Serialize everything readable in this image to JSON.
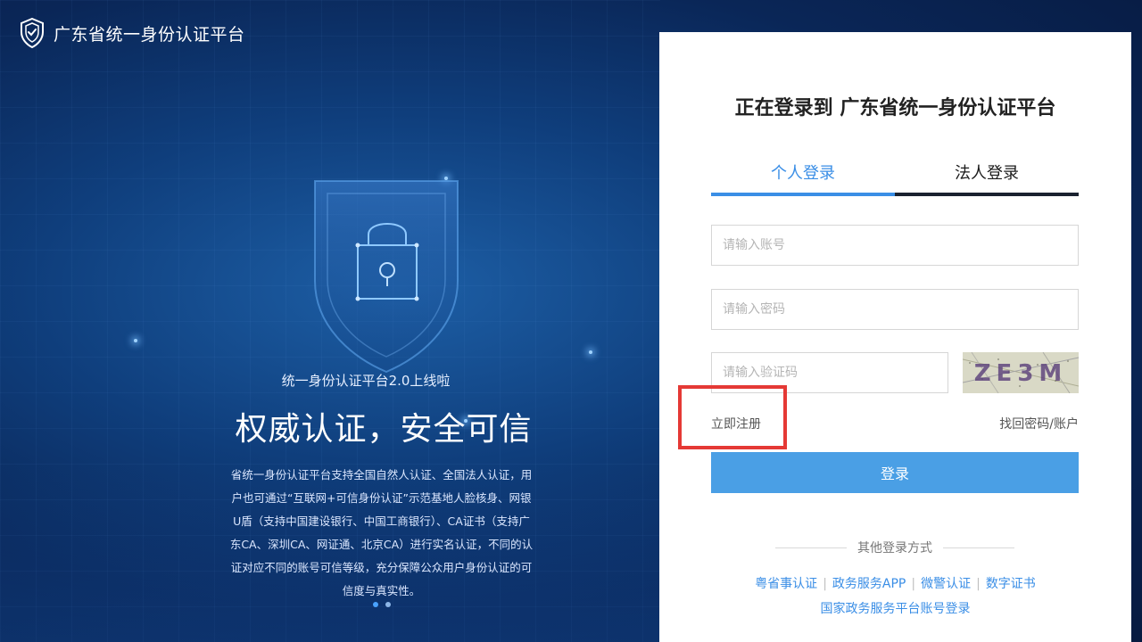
{
  "brand": {
    "name": "广东省统一身份认证平台",
    "icon": "shield-check-icon"
  },
  "hero": {
    "subtitle": "统一身份认证平台2.0上线啦",
    "title": "权威认证，安全可信",
    "description": "省统一身份认证平台支持全国自然人认证、全国法人认证，用户也可通过“互联网+可信身份认证”示范基地人脸核身、网银U盾（支持中国建设银行、中国工商银行）、CA证书（支持广东CA、深圳CA、网证通、北京CA）进行实名认证，不同的认证对应不同的账号可信等级，充分保障公众用户身份认证的可信度与真实性。",
    "illustration": "shield-lock-icon",
    "carousel_total": 2,
    "carousel_active": 0
  },
  "login": {
    "title": "正在登录到 广东省统一身份认证平台",
    "tabs": [
      {
        "label": "个人登录",
        "active": true
      },
      {
        "label": "法人登录",
        "active": false
      }
    ],
    "account_placeholder": "请输入账号",
    "account_value": "",
    "password_placeholder": "请输入密码",
    "password_value": "",
    "captcha_placeholder": "请输入验证码",
    "captcha_value": "",
    "captcha_text": "ZE3M",
    "register_label": "立即注册",
    "forgot_label": "找回密码/账户",
    "submit_label": "登录",
    "other_title": "其他登录方式",
    "other_methods": [
      "粤省事认证",
      "政务服务APP",
      "微警认证",
      "数字证书"
    ],
    "national_label": "国家政务服务平台账号登录"
  },
  "colors": {
    "accent": "#3a8ee6",
    "button": "#4a9fe5",
    "highlight": "#e53935",
    "bg_dark": "#0a2657"
  }
}
